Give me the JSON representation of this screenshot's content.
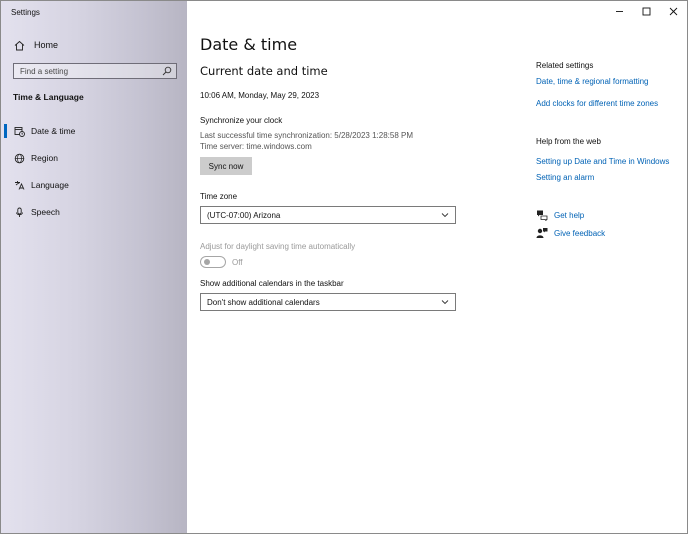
{
  "window": {
    "title": "Settings",
    "controls": {
      "minimize_icon": "minimize-icon",
      "maximize_icon": "maximize-icon",
      "close_icon": "close-icon"
    }
  },
  "sidebar": {
    "home_label": "Home",
    "search_placeholder": "Find a setting",
    "section_title": "Time & Language",
    "items": [
      {
        "label": "Date & time",
        "icon": "calendar-clock-icon",
        "selected": true
      },
      {
        "label": "Region",
        "icon": "globe-icon",
        "selected": false
      },
      {
        "label": "Language",
        "icon": "language-icon",
        "selected": false
      },
      {
        "label": "Speech",
        "icon": "microphone-icon",
        "selected": false
      }
    ]
  },
  "main": {
    "page_title": "Date & time",
    "section_title": "Current date and time",
    "current_datetime": "10:06 AM, Monday, May 29, 2023",
    "sync": {
      "title": "Synchronize your clock",
      "last_sync": "Last successful time synchronization: 5/28/2023 1:28:58 PM",
      "time_server": "Time server: time.windows.com",
      "button_label": "Sync now"
    },
    "time_zone": {
      "label": "Time zone",
      "value": "(UTC-07:00) Arizona"
    },
    "daylight": {
      "label": "Adjust for daylight saving time automatically",
      "state": "Off"
    },
    "calendars": {
      "label": "Show additional calendars in the taskbar",
      "value": "Don't show additional calendars"
    }
  },
  "related": {
    "title": "Related settings",
    "links": [
      "Date, time & regional formatting",
      "Add clocks for different time zones"
    ]
  },
  "help_web": {
    "title": "Help from the web",
    "links": [
      "Setting up Date and Time in Windows",
      "Setting an alarm"
    ]
  },
  "support": {
    "get_help": "Get help",
    "give_feedback": "Give feedback"
  },
  "colors": {
    "accent": "#0067c0",
    "link": "#0062b5"
  }
}
